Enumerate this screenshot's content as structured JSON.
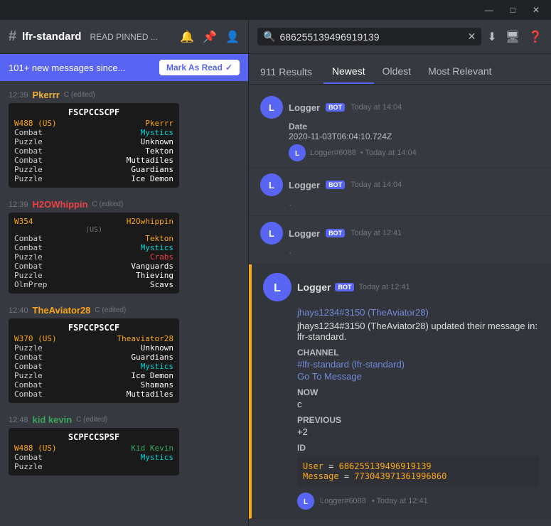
{
  "titlebar": {
    "minimize": "—",
    "maximize": "□",
    "close": "✕"
  },
  "leftPanel": {
    "channel": {
      "hash": "#",
      "name": "lfr-standard",
      "readPinned": "READ PINNED ...",
      "icons": [
        "🔔",
        "📌",
        "👤"
      ]
    },
    "banner": {
      "text": "101+ new messages since...",
      "markAsRead": "Mark As Read",
      "icon": "📩"
    },
    "messages": [
      {
        "time": "12:39",
        "author": "Pkerrr",
        "authorClass": "author-pkerrr",
        "edited": "C (edited)",
        "card": {
          "header": "FSCPCCSCPF",
          "subheader": "W488 (US)   Pkerrr",
          "rows": [
            [
              "Combat",
              "Mystics"
            ],
            [
              "Puzzle",
              "Unknown"
            ],
            [
              "Combat",
              "Tekton"
            ],
            [
              "Combat",
              "Muttadiles"
            ],
            [
              "Puzzle",
              "Guardians"
            ],
            [
              "Puzzle",
              "Ice Demon"
            ]
          ]
        }
      },
      {
        "time": "12:39",
        "author": "H2OWhippin",
        "authorClass": "author-h2o",
        "edited": "C (edited)",
        "card": {
          "header": "W354",
          "subheader": "H2Owhippin",
          "subheaderLabel": "(US)",
          "rows": [
            [
              "Combat",
              "Tekton"
            ],
            [
              "Combat",
              "Mystics"
            ],
            [
              "Puzzle",
              "Crabs"
            ],
            [
              "Combat",
              "Vanguards"
            ],
            [
              "Puzzle",
              "Thieving"
            ],
            [
              "OlmPrep",
              "Scavs"
            ]
          ]
        }
      },
      {
        "time": "12:40",
        "author": "TheAviator28",
        "authorClass": "author-aviator",
        "edited": "C (edited)",
        "card": {
          "header": "FSPCCPSCCF",
          "subheader": "W370 (US)   Theaviator28",
          "rows": [
            [
              "Puzzle",
              "Unknown"
            ],
            [
              "Combat",
              "Guardians"
            ],
            [
              "Combat",
              "Mystics"
            ],
            [
              "Puzzle",
              "Ice Demon"
            ],
            [
              "Combat",
              "Shamans"
            ],
            [
              "Combat",
              "Muttadiles"
            ]
          ]
        }
      },
      {
        "time": "12:48",
        "author": "kid kevin",
        "authorClass": "author-kidkevin",
        "edited": "C (edited)",
        "card": {
          "header": "SCPFCCSPSF",
          "subheader": "W488 (US)   Kid Kevin",
          "rows": [
            [
              "Combat",
              "Mystics"
            ],
            [
              "Puzzle",
              ""
            ]
          ]
        }
      }
    ]
  },
  "rightPanel": {
    "searchValue": "686255139496919139",
    "resultsCount": "911 Results",
    "tabs": [
      {
        "label": "Newest",
        "active": true
      },
      {
        "label": "Oldest",
        "active": false
      },
      {
        "label": "Most Relevant",
        "active": false
      }
    ],
    "results": [
      {
        "id": "r1",
        "avatarText": "L",
        "authorName": "Logger",
        "isBot": true,
        "time": "Today at 14:04",
        "bodyPreview": "Date\n2020-11-03T06:04:10.724Z",
        "footerAuthor": "Logger#6088",
        "footerTime": "Today at 14:04"
      },
      {
        "id": "r2",
        "avatarText": "L",
        "authorName": "Logger",
        "isBot": true,
        "time": "Today at 14:04",
        "bodyPreview": "..."
      },
      {
        "id": "r3",
        "avatarText": "L",
        "authorName": "Logger",
        "isBot": true,
        "time": "Today at 12:41",
        "bodyPreview": "..."
      }
    ],
    "mainResult": {
      "avatarText": "L",
      "authorName": "Logger",
      "isBot": true,
      "time": "Today at 12:41",
      "mentionName": "jhays1234#3150 (TheAviator28)",
      "description": "jhays1234#3150 (TheAviator28) updated their message in: lfr-standard.",
      "fields": [
        {
          "label": "Channel",
          "type": "link",
          "value": "#lfr-standard (lfr-standard)",
          "extra": "Go To Message"
        },
        {
          "label": "Now",
          "type": "text",
          "value": "c"
        },
        {
          "label": "Previous",
          "type": "text",
          "value": "+2"
        },
        {
          "label": "ID",
          "type": "code",
          "userLabel": "User",
          "userValue": "686255139496919139",
          "messageLabel": "Message",
          "messageValue": "773043971361996860"
        }
      ],
      "footer": {
        "avatarText": "L",
        "authorName": "Logger#6088",
        "time": "Today at 12:41"
      }
    }
  }
}
